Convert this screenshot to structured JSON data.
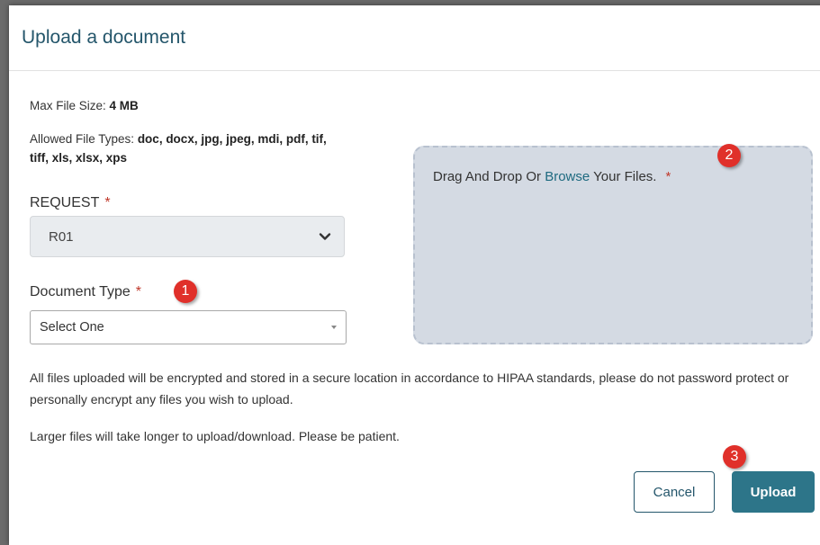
{
  "dialog": {
    "title": "Upload a document"
  },
  "file_info": {
    "max_size_label": "Max File Size: ",
    "max_size_value": "4 MB",
    "allowed_label": "Allowed File Types: ",
    "allowed_value": "doc, docx, jpg, jpeg, mdi, pdf, tif, tiff, xls, xlsx, xps"
  },
  "request_field": {
    "label": "REQUEST",
    "required_mark": "*",
    "value": "R01"
  },
  "document_type_field": {
    "label": "Document Type",
    "required_mark": "*",
    "value": "Select One"
  },
  "dropzone": {
    "text_before": "Drag And Drop Or ",
    "browse_link": "Browse",
    "text_after": " Your Files.",
    "required_mark": "*"
  },
  "notices": {
    "encryption": "All files uploaded will be encrypted and stored in a secure location in accordance to HIPAA standards, please do not password protect or personally encrypt any files you wish to upload.",
    "large_files": "Larger files will take longer to upload/download. Please be patient."
  },
  "buttons": {
    "cancel": "Cancel",
    "upload": "Upload"
  },
  "callouts": [
    "1",
    "2",
    "3"
  ],
  "colors": {
    "title": "#24566b",
    "primary_button": "#2d7589",
    "required": "#c0392b",
    "callout": "#e0302a",
    "dropzone_bg": "#d4dae3"
  },
  "icons": {
    "request_select": "chevron-down-icon",
    "document_select": "caret-down-icon"
  }
}
